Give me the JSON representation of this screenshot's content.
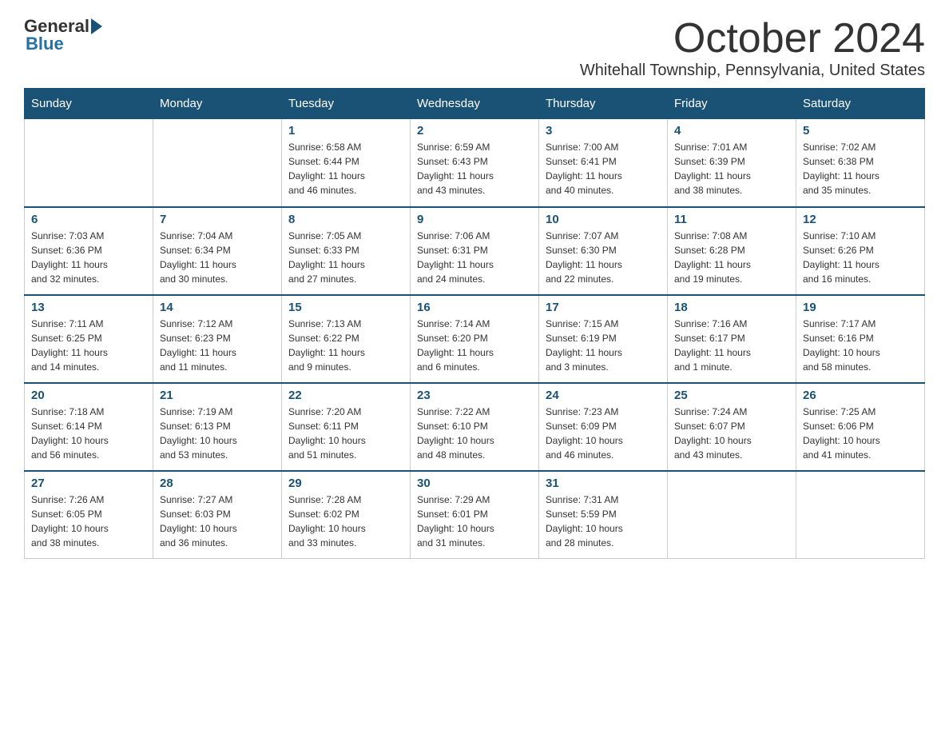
{
  "logo": {
    "general": "General",
    "blue": "Blue"
  },
  "header": {
    "month": "October 2024",
    "location": "Whitehall Township, Pennsylvania, United States"
  },
  "weekdays": [
    "Sunday",
    "Monday",
    "Tuesday",
    "Wednesday",
    "Thursday",
    "Friday",
    "Saturday"
  ],
  "weeks": [
    [
      {
        "day": "",
        "info": ""
      },
      {
        "day": "",
        "info": ""
      },
      {
        "day": "1",
        "info": "Sunrise: 6:58 AM\nSunset: 6:44 PM\nDaylight: 11 hours\nand 46 minutes."
      },
      {
        "day": "2",
        "info": "Sunrise: 6:59 AM\nSunset: 6:43 PM\nDaylight: 11 hours\nand 43 minutes."
      },
      {
        "day": "3",
        "info": "Sunrise: 7:00 AM\nSunset: 6:41 PM\nDaylight: 11 hours\nand 40 minutes."
      },
      {
        "day": "4",
        "info": "Sunrise: 7:01 AM\nSunset: 6:39 PM\nDaylight: 11 hours\nand 38 minutes."
      },
      {
        "day": "5",
        "info": "Sunrise: 7:02 AM\nSunset: 6:38 PM\nDaylight: 11 hours\nand 35 minutes."
      }
    ],
    [
      {
        "day": "6",
        "info": "Sunrise: 7:03 AM\nSunset: 6:36 PM\nDaylight: 11 hours\nand 32 minutes."
      },
      {
        "day": "7",
        "info": "Sunrise: 7:04 AM\nSunset: 6:34 PM\nDaylight: 11 hours\nand 30 minutes."
      },
      {
        "day": "8",
        "info": "Sunrise: 7:05 AM\nSunset: 6:33 PM\nDaylight: 11 hours\nand 27 minutes."
      },
      {
        "day": "9",
        "info": "Sunrise: 7:06 AM\nSunset: 6:31 PM\nDaylight: 11 hours\nand 24 minutes."
      },
      {
        "day": "10",
        "info": "Sunrise: 7:07 AM\nSunset: 6:30 PM\nDaylight: 11 hours\nand 22 minutes."
      },
      {
        "day": "11",
        "info": "Sunrise: 7:08 AM\nSunset: 6:28 PM\nDaylight: 11 hours\nand 19 minutes."
      },
      {
        "day": "12",
        "info": "Sunrise: 7:10 AM\nSunset: 6:26 PM\nDaylight: 11 hours\nand 16 minutes."
      }
    ],
    [
      {
        "day": "13",
        "info": "Sunrise: 7:11 AM\nSunset: 6:25 PM\nDaylight: 11 hours\nand 14 minutes."
      },
      {
        "day": "14",
        "info": "Sunrise: 7:12 AM\nSunset: 6:23 PM\nDaylight: 11 hours\nand 11 minutes."
      },
      {
        "day": "15",
        "info": "Sunrise: 7:13 AM\nSunset: 6:22 PM\nDaylight: 11 hours\nand 9 minutes."
      },
      {
        "day": "16",
        "info": "Sunrise: 7:14 AM\nSunset: 6:20 PM\nDaylight: 11 hours\nand 6 minutes."
      },
      {
        "day": "17",
        "info": "Sunrise: 7:15 AM\nSunset: 6:19 PM\nDaylight: 11 hours\nand 3 minutes."
      },
      {
        "day": "18",
        "info": "Sunrise: 7:16 AM\nSunset: 6:17 PM\nDaylight: 11 hours\nand 1 minute."
      },
      {
        "day": "19",
        "info": "Sunrise: 7:17 AM\nSunset: 6:16 PM\nDaylight: 10 hours\nand 58 minutes."
      }
    ],
    [
      {
        "day": "20",
        "info": "Sunrise: 7:18 AM\nSunset: 6:14 PM\nDaylight: 10 hours\nand 56 minutes."
      },
      {
        "day": "21",
        "info": "Sunrise: 7:19 AM\nSunset: 6:13 PM\nDaylight: 10 hours\nand 53 minutes."
      },
      {
        "day": "22",
        "info": "Sunrise: 7:20 AM\nSunset: 6:11 PM\nDaylight: 10 hours\nand 51 minutes."
      },
      {
        "day": "23",
        "info": "Sunrise: 7:22 AM\nSunset: 6:10 PM\nDaylight: 10 hours\nand 48 minutes."
      },
      {
        "day": "24",
        "info": "Sunrise: 7:23 AM\nSunset: 6:09 PM\nDaylight: 10 hours\nand 46 minutes."
      },
      {
        "day": "25",
        "info": "Sunrise: 7:24 AM\nSunset: 6:07 PM\nDaylight: 10 hours\nand 43 minutes."
      },
      {
        "day": "26",
        "info": "Sunrise: 7:25 AM\nSunset: 6:06 PM\nDaylight: 10 hours\nand 41 minutes."
      }
    ],
    [
      {
        "day": "27",
        "info": "Sunrise: 7:26 AM\nSunset: 6:05 PM\nDaylight: 10 hours\nand 38 minutes."
      },
      {
        "day": "28",
        "info": "Sunrise: 7:27 AM\nSunset: 6:03 PM\nDaylight: 10 hours\nand 36 minutes."
      },
      {
        "day": "29",
        "info": "Sunrise: 7:28 AM\nSunset: 6:02 PM\nDaylight: 10 hours\nand 33 minutes."
      },
      {
        "day": "30",
        "info": "Sunrise: 7:29 AM\nSunset: 6:01 PM\nDaylight: 10 hours\nand 31 minutes."
      },
      {
        "day": "31",
        "info": "Sunrise: 7:31 AM\nSunset: 5:59 PM\nDaylight: 10 hours\nand 28 minutes."
      },
      {
        "day": "",
        "info": ""
      },
      {
        "day": "",
        "info": ""
      }
    ]
  ]
}
